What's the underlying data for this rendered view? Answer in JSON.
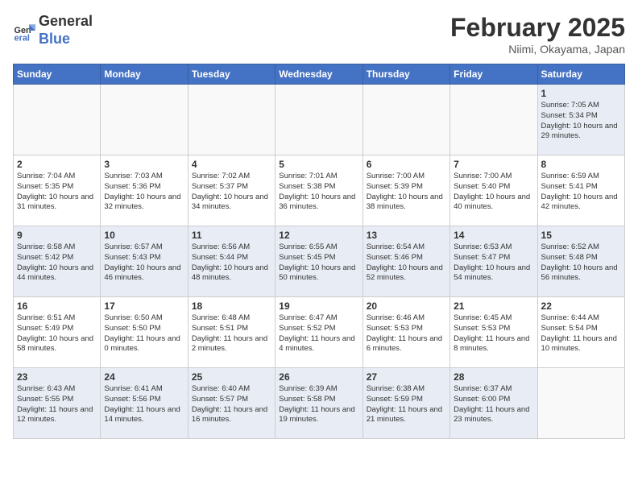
{
  "header": {
    "logo_general": "General",
    "logo_blue": "Blue",
    "title": "February 2025",
    "subtitle": "Niimi, Okayama, Japan"
  },
  "weekdays": [
    "Sunday",
    "Monday",
    "Tuesday",
    "Wednesday",
    "Thursday",
    "Friday",
    "Saturday"
  ],
  "weeks": [
    [
      {
        "day": "",
        "info": ""
      },
      {
        "day": "",
        "info": ""
      },
      {
        "day": "",
        "info": ""
      },
      {
        "day": "",
        "info": ""
      },
      {
        "day": "",
        "info": ""
      },
      {
        "day": "",
        "info": ""
      },
      {
        "day": "1",
        "info": "Sunrise: 7:05 AM\nSunset: 5:34 PM\nDaylight: 10 hours\nand 29 minutes."
      }
    ],
    [
      {
        "day": "2",
        "info": "Sunrise: 7:04 AM\nSunset: 5:35 PM\nDaylight: 10 hours\nand 31 minutes."
      },
      {
        "day": "3",
        "info": "Sunrise: 7:03 AM\nSunset: 5:36 PM\nDaylight: 10 hours\nand 32 minutes."
      },
      {
        "day": "4",
        "info": "Sunrise: 7:02 AM\nSunset: 5:37 PM\nDaylight: 10 hours\nand 34 minutes."
      },
      {
        "day": "5",
        "info": "Sunrise: 7:01 AM\nSunset: 5:38 PM\nDaylight: 10 hours\nand 36 minutes."
      },
      {
        "day": "6",
        "info": "Sunrise: 7:00 AM\nSunset: 5:39 PM\nDaylight: 10 hours\nand 38 minutes."
      },
      {
        "day": "7",
        "info": "Sunrise: 7:00 AM\nSunset: 5:40 PM\nDaylight: 10 hours\nand 40 minutes."
      },
      {
        "day": "8",
        "info": "Sunrise: 6:59 AM\nSunset: 5:41 PM\nDaylight: 10 hours\nand 42 minutes."
      }
    ],
    [
      {
        "day": "9",
        "info": "Sunrise: 6:58 AM\nSunset: 5:42 PM\nDaylight: 10 hours\nand 44 minutes."
      },
      {
        "day": "10",
        "info": "Sunrise: 6:57 AM\nSunset: 5:43 PM\nDaylight: 10 hours\nand 46 minutes."
      },
      {
        "day": "11",
        "info": "Sunrise: 6:56 AM\nSunset: 5:44 PM\nDaylight: 10 hours\nand 48 minutes."
      },
      {
        "day": "12",
        "info": "Sunrise: 6:55 AM\nSunset: 5:45 PM\nDaylight: 10 hours\nand 50 minutes."
      },
      {
        "day": "13",
        "info": "Sunrise: 6:54 AM\nSunset: 5:46 PM\nDaylight: 10 hours\nand 52 minutes."
      },
      {
        "day": "14",
        "info": "Sunrise: 6:53 AM\nSunset: 5:47 PM\nDaylight: 10 hours\nand 54 minutes."
      },
      {
        "day": "15",
        "info": "Sunrise: 6:52 AM\nSunset: 5:48 PM\nDaylight: 10 hours\nand 56 minutes."
      }
    ],
    [
      {
        "day": "16",
        "info": "Sunrise: 6:51 AM\nSunset: 5:49 PM\nDaylight: 10 hours\nand 58 minutes."
      },
      {
        "day": "17",
        "info": "Sunrise: 6:50 AM\nSunset: 5:50 PM\nDaylight: 11 hours\nand 0 minutes."
      },
      {
        "day": "18",
        "info": "Sunrise: 6:48 AM\nSunset: 5:51 PM\nDaylight: 11 hours\nand 2 minutes."
      },
      {
        "day": "19",
        "info": "Sunrise: 6:47 AM\nSunset: 5:52 PM\nDaylight: 11 hours\nand 4 minutes."
      },
      {
        "day": "20",
        "info": "Sunrise: 6:46 AM\nSunset: 5:53 PM\nDaylight: 11 hours\nand 6 minutes."
      },
      {
        "day": "21",
        "info": "Sunrise: 6:45 AM\nSunset: 5:53 PM\nDaylight: 11 hours\nand 8 minutes."
      },
      {
        "day": "22",
        "info": "Sunrise: 6:44 AM\nSunset: 5:54 PM\nDaylight: 11 hours\nand 10 minutes."
      }
    ],
    [
      {
        "day": "23",
        "info": "Sunrise: 6:43 AM\nSunset: 5:55 PM\nDaylight: 11 hours\nand 12 minutes."
      },
      {
        "day": "24",
        "info": "Sunrise: 6:41 AM\nSunset: 5:56 PM\nDaylight: 11 hours\nand 14 minutes."
      },
      {
        "day": "25",
        "info": "Sunrise: 6:40 AM\nSunset: 5:57 PM\nDaylight: 11 hours\nand 16 minutes."
      },
      {
        "day": "26",
        "info": "Sunrise: 6:39 AM\nSunset: 5:58 PM\nDaylight: 11 hours\nand 19 minutes."
      },
      {
        "day": "27",
        "info": "Sunrise: 6:38 AM\nSunset: 5:59 PM\nDaylight: 11 hours\nand 21 minutes."
      },
      {
        "day": "28",
        "info": "Sunrise: 6:37 AM\nSunset: 6:00 PM\nDaylight: 11 hours\nand 23 minutes."
      },
      {
        "day": "",
        "info": ""
      }
    ]
  ]
}
